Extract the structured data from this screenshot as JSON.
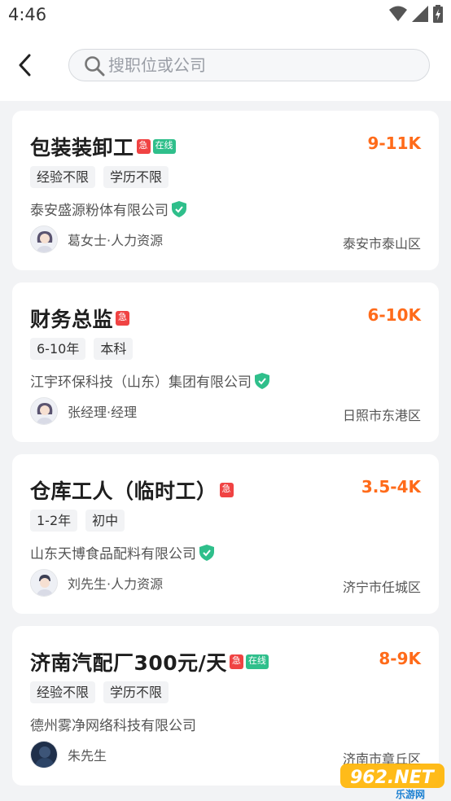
{
  "status_bar": {
    "time": "4:46"
  },
  "search": {
    "placeholder": "搜职位或公司",
    "value": ""
  },
  "jobs": [
    {
      "title": "包装装卸工",
      "badges": [
        "急",
        "在线"
      ],
      "salary": "9-11K",
      "tags": [
        "经验不限",
        "学历不限"
      ],
      "company": "泰安盛源粉体有限公司",
      "verified": true,
      "recruiter": "葛女士·人力资源",
      "avatar": "female-avatar-icon",
      "location": "泰安市泰山区"
    },
    {
      "title": "财务总监",
      "badges": [
        "急"
      ],
      "salary": "6-10K",
      "tags": [
        "6-10年",
        "本科"
      ],
      "company": "江宇环保科技（山东）集团有限公司",
      "verified": true,
      "recruiter": "张经理·经理",
      "avatar": "female-avatar-icon",
      "location": "日照市东港区"
    },
    {
      "title": "仓库工人（临时工）",
      "badges": [
        "急"
      ],
      "salary": "3.5-4K",
      "tags": [
        "1-2年",
        "初中"
      ],
      "company": "山东天博食品配料有限公司",
      "verified": true,
      "recruiter": "刘先生·人力资源",
      "avatar": "male-avatar-icon",
      "location": "济宁市任城区"
    },
    {
      "title": "济南汽配厂300元/天",
      "badges": [
        "急",
        "在线"
      ],
      "salary": "8-9K",
      "tags": [
        "经验不限",
        "学历不限"
      ],
      "company": "德州雾净网络科技有限公司",
      "verified": false,
      "recruiter": "朱先生",
      "avatar": "photo-avatar-icon",
      "location": "济南市章丘区"
    }
  ],
  "watermark": {
    "text": "962.NET",
    "subtext": "乐游网"
  },
  "colors": {
    "salary": "#ff6b1a",
    "urgent_badge": "#f04343",
    "online_badge": "#2fbf8b",
    "verified": "#2fbf8b",
    "background": "#f2f3f5"
  }
}
